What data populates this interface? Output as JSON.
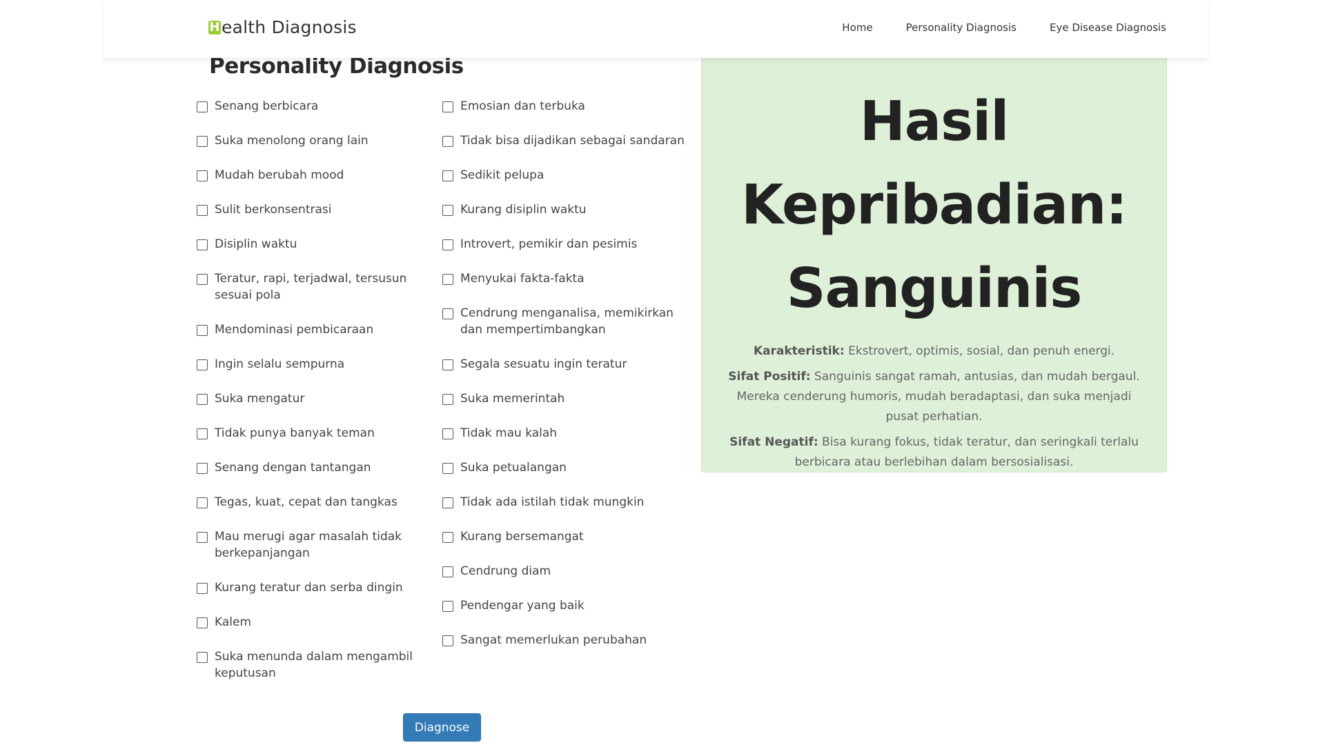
{
  "brand": {
    "mark": "H",
    "rest": "ealth Diagnosis"
  },
  "nav": [
    {
      "label": "Home"
    },
    {
      "label": "Personality Diagnosis"
    },
    {
      "label": "Eye Disease Diagnosis"
    }
  ],
  "page_title": "Personality Diagnosis",
  "column_1": [
    "Senang berbicara",
    "Suka menolong orang lain",
    "Mudah berubah mood",
    "Sulit berkonsentrasi",
    "Disiplin waktu",
    "Teratur, rapi, terjadwal, tersusun sesuai pola",
    "Mendominasi pembicaraan",
    "Ingin selalu sempurna",
    "Suka mengatur",
    "Tidak punya banyak teman",
    "Senang dengan tantangan",
    "Tegas, kuat, cepat dan tangkas",
    "Mau merugi agar masalah tidak berkepanjangan",
    "Kurang teratur dan serba dingin",
    "Kalem",
    "Suka menunda dalam mengambil keputusan"
  ],
  "column_2": [
    "Emosian dan terbuka",
    "Tidak bisa dijadikan sebagai sandaran",
    "Sedikit pelupa",
    "Kurang disiplin waktu",
    "Introvert, pemikir dan pesimis",
    "Menyukai fakta-fakta",
    "Cendrung menganalisa, memikirkan dan mempertimbangkan",
    "Segala sesuatu ingin teratur",
    "Suka memerintah",
    "Tidak mau kalah",
    "Suka petualangan",
    "Tidak ada istilah tidak mungkin",
    "Kurang bersemangat",
    "Cendrung diam",
    "Pendengar yang baik",
    "Sangat memerlukan perubahan"
  ],
  "diagnose_button": "Diagnose",
  "result": {
    "title": "Hasil Kepribadian: Sanguinis",
    "karakteristik_label": "Karakteristik:",
    "karakteristik_text": " Ekstrovert, optimis, sosial, dan penuh energi.",
    "positif_label": "Sifat Positif:",
    "positif_text": " Sanguinis sangat ramah, antusias, dan mudah bergaul. Mereka cenderung humoris, mudah beradaptasi, dan suka menjadi pusat perhatian.",
    "negatif_label": "Sifat Negatif:",
    "negatif_text": " Bisa kurang fokus, tidak teratur, dan seringkali terlalu berbicara atau berlebihan dalam bersosialisasi."
  },
  "colors": {
    "brand_mark": "#9acd32",
    "button": "#337ab7",
    "result_bg": "#dff0d8"
  }
}
